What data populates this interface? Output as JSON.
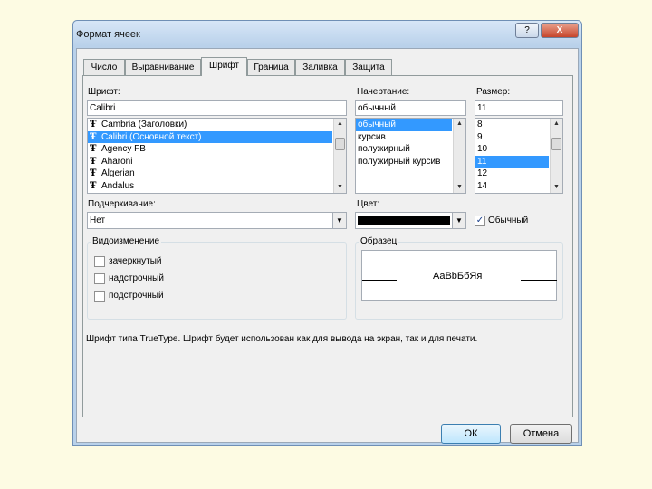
{
  "window": {
    "title": "Формат ячеек",
    "help_label": "?",
    "close_label": "X"
  },
  "tabs": [
    {
      "label": "Число"
    },
    {
      "label": "Выравнивание"
    },
    {
      "label": "Шрифт",
      "active": true
    },
    {
      "label": "Граница"
    },
    {
      "label": "Заливка"
    },
    {
      "label": "Защита"
    }
  ],
  "font": {
    "label": "Шрифт:",
    "value": "Calibri",
    "icon": "truetype-font-icon",
    "items": [
      {
        "label": "Cambria (Заголовки)"
      },
      {
        "label": "Calibri (Основной текст)",
        "selected": true
      },
      {
        "label": "Agency FB"
      },
      {
        "label": "Aharoni"
      },
      {
        "label": "Algerian"
      },
      {
        "label": "Andalus"
      }
    ]
  },
  "style": {
    "label": "Начертание:",
    "value": "обычный",
    "items": [
      {
        "label": "обычный",
        "selected": true
      },
      {
        "label": "курсив"
      },
      {
        "label": "полужирный"
      },
      {
        "label": "полужирный курсив"
      }
    ]
  },
  "size": {
    "label": "Размер:",
    "value": "11",
    "items": [
      {
        "label": "8"
      },
      {
        "label": "9"
      },
      {
        "label": "10"
      },
      {
        "label": "11",
        "selected": true
      },
      {
        "label": "12"
      },
      {
        "label": "14"
      }
    ]
  },
  "underline": {
    "label": "Подчеркивание:",
    "value": "Нет"
  },
  "color": {
    "label": "Цвет:",
    "value_color": "#000000",
    "normal_label": "Обычный",
    "normal_checked": true,
    "check_mark": "✓"
  },
  "effects": {
    "label": "Видоизменение",
    "items": [
      {
        "label": "зачеркнутый",
        "checked": false
      },
      {
        "label": "надстрочный",
        "checked": false
      },
      {
        "label": "подстрочный",
        "checked": false
      }
    ]
  },
  "sample": {
    "label": "Образец",
    "text": "AaBbБбЯя"
  },
  "info_text": "Шрифт типа TrueType. Шрифт будет использован как для вывода на экран, так и для печати.",
  "buttons": {
    "ok": "ОК",
    "cancel": "Отмена"
  },
  "icons": {
    "scroll_up": "▲",
    "scroll_down": "▼",
    "dropdown": "▼"
  }
}
